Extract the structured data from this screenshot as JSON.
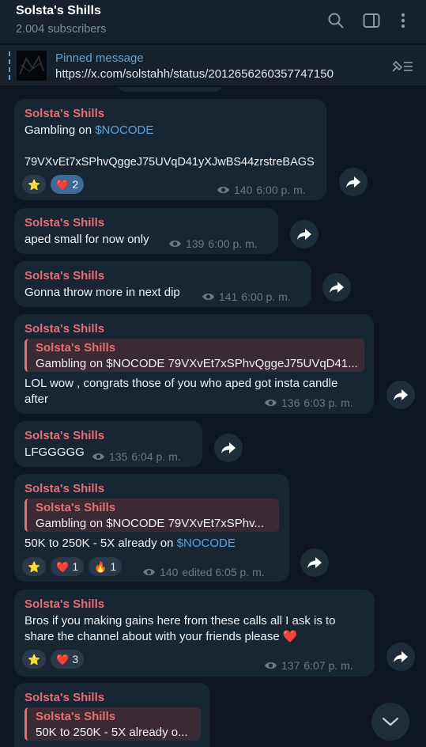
{
  "header": {
    "title": "Solsta's Shills",
    "subscribers": "2.004 subscribers",
    "icons": [
      "search-icon",
      "sidebar-icon",
      "more-vertical-icon"
    ]
  },
  "pinned": {
    "title": "Pinned message",
    "text": "https://x.com/solstahh/status/2012656260357747150"
  },
  "messages": [
    {
      "author": "Solsta's Shills",
      "line1_prefix": "Gambling on ",
      "line1_link": "$NOCODE",
      "line2": "79VXvEt7xSPhvQggeJ75UVqD41yXJwBS44zrstreBAGS",
      "reactions": [
        {
          "emoji": "⭐",
          "count": ""
        },
        {
          "emoji": "❤️",
          "count": "2"
        }
      ],
      "views": "140",
      "time": "6:00 p. m."
    },
    {
      "author": "Solsta's Shills",
      "text": "aped small for now only",
      "views": "139",
      "time": "6:00 p. m."
    },
    {
      "author": "Solsta's Shills",
      "text": "Gonna throw more in next dip",
      "views": "141",
      "time": "6:00 p. m."
    },
    {
      "author": "Solsta's Shills",
      "reply_author": "Solsta's Shills",
      "reply_text": "Gambling on $NOCODE  79VXvEt7xSPhvQggeJ75UVqD41...",
      "line1": "LOL wow , congrats those of you who aped got insta candle",
      "line2": "after",
      "views": "136",
      "time": "6:03 p. m."
    },
    {
      "author": "Solsta's Shills",
      "text": "LFGGGGG",
      "views": "135",
      "time": "6:04 p. m."
    },
    {
      "author": "Solsta's Shills",
      "reply_author": "Solsta's Shills",
      "reply_text": "Gambling on $NOCODE  79VXvEt7xSPhv...",
      "text_prefix": "50K to 250K - 5X already on ",
      "text_link": "$NOCODE",
      "reactions": [
        {
          "emoji": "⭐",
          "count": ""
        },
        {
          "emoji": "❤️",
          "count": "1"
        },
        {
          "emoji": "🔥",
          "count": "1"
        }
      ],
      "views": "140",
      "time": "edited 6:05 p. m."
    },
    {
      "author": "Solsta's Shills",
      "line1": "Bros if you making gains here from these calls all I ask is to",
      "line2": "share the channel about with your friends please",
      "line2_emoji": "❤️",
      "reactions": [
        {
          "emoji": "⭐",
          "count": ""
        },
        {
          "emoji": "❤️",
          "count": "3"
        }
      ],
      "views": "137",
      "time": "6:07 p. m."
    },
    {
      "author": "Solsta's Shills",
      "reply_author": "Solsta's Shills",
      "reply_text": "50K to 250K - 5X already o..."
    }
  ],
  "colors": {
    "background": "#0e1621",
    "bubble": "#182533",
    "author": "#e86d74",
    "link": "#5aa3e0",
    "meta": "#6c7883"
  }
}
